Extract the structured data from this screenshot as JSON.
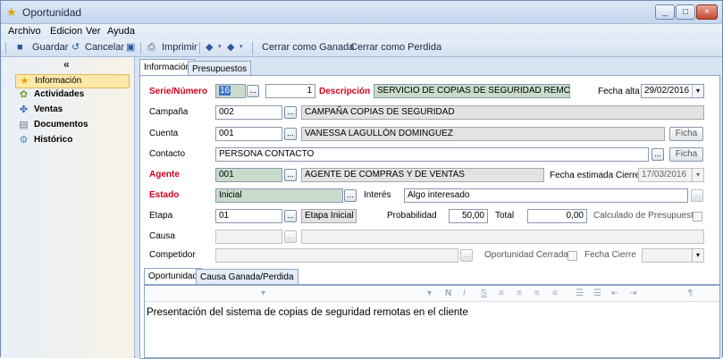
{
  "window": {
    "title": "Oportunidad",
    "controls": [
      "_",
      "□",
      "×"
    ]
  },
  "menu": [
    "Archivo",
    "Edicion",
    "Ver",
    "Ayuda"
  ],
  "toolbar": {
    "save": "Guardar",
    "cancel": "Cancelar",
    "print": "Imprimir",
    "close_won": "Cerrar como Ganada",
    "close_lost": "Cerrar como Perdida"
  },
  "sidebar": {
    "collapse": "«",
    "items": [
      {
        "label": "Información",
        "icon": "star-icon"
      },
      {
        "label": "Actividades",
        "icon": "activities-icon"
      },
      {
        "label": "Ventas",
        "icon": "sales-icon"
      },
      {
        "label": "Documentos",
        "icon": "documents-icon"
      },
      {
        "label": "Histórico",
        "icon": "history-icon"
      }
    ]
  },
  "tabs": [
    "Información",
    "Presupuestos"
  ],
  "form": {
    "serie_label": "Serie/Número",
    "serie_value": "16",
    "numero_value": "1",
    "descripcion_label": "Descripción",
    "descripcion_value": "SERVICIO DE COPIAS DE SEGURIDAD REMOTAS",
    "fecha_alta_label": "Fecha alta",
    "fecha_alta_value": "29/02/2016",
    "campana_label": "Campaña",
    "campana_code": "002",
    "campana_name": "CAMPAÑA COPIAS DE SEGURIDAD",
    "cuenta_label": "Cuenta",
    "cuenta_code": "001",
    "cuenta_name": "VANESSA LAGULLÓN DOMINGUEZ",
    "ficha_label": "Ficha",
    "contacto_label": "Contacto",
    "contacto_value": "PERSONA CONTACTO",
    "agente_label": "Agente",
    "agente_code": "001",
    "agente_name": "AGENTE DE COMPRAS Y DE VENTAS",
    "fecha_cierre_est_label": "Fecha estimada Cierre",
    "fecha_cierre_est_value": "17/03/2016",
    "estado_label": "Estado",
    "estado_value": "Inicial",
    "interes_label": "Interés",
    "interes_value": "Algo interesado",
    "etapa_label": "Etapa",
    "etapa_code": "01",
    "etapa_name": "Etapa Inicial",
    "probabilidad_label": "Probabilidad",
    "probabilidad_value": "50,00",
    "total_label": "Total",
    "total_value": "0,00",
    "calculado_label": "Calculado de Presupuestos",
    "causa_label": "Causa",
    "competidor_label": "Competidor",
    "oportunidad_cerrada_label": "Oportunidad Cerrada",
    "fecha_cierre_label": "Fecha Cierre",
    "dots": "...",
    "arrow": "▾"
  },
  "subtabs": [
    "Oportunidad",
    "Causa Ganada/Perdida"
  ],
  "editor": {
    "toolbar": [
      "▾",
      "▾",
      "N",
      "I",
      "S"
    ],
    "text": "Presentación del sistema de copias de seguridad remotas en el cliente"
  }
}
